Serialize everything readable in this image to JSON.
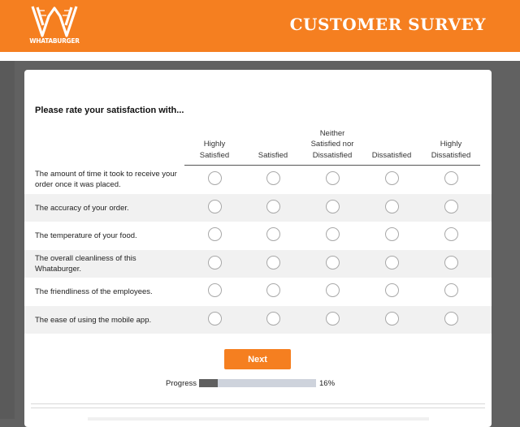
{
  "header": {
    "brand": "WHATABURGER",
    "title": "CUSTOMER SURVEY"
  },
  "survey": {
    "prompt": "Please rate your satisfaction with...",
    "columns": [
      "Highly\nSatisfied",
      "Satisfied",
      "Neither\nSatisfied nor\nDissatisfied",
      "Dissatisfied",
      "Highly\nDissatisfied"
    ],
    "rows": [
      "The amount of time it took to receive your order once it was placed.",
      "The accuracy of your order.",
      "The temperature of your food.",
      "The overall cleanliness of this Whataburger.",
      "The friendliness of the employees.",
      "The ease of using the mobile app."
    ],
    "selected": [
      null,
      null,
      null,
      null,
      null,
      null
    ]
  },
  "navigation": {
    "next_label": "Next"
  },
  "progress": {
    "label": "Progress",
    "percent_text": "16%",
    "value": 16
  },
  "colors": {
    "brand_orange": "#f57f20",
    "page_grey": "#616161"
  }
}
